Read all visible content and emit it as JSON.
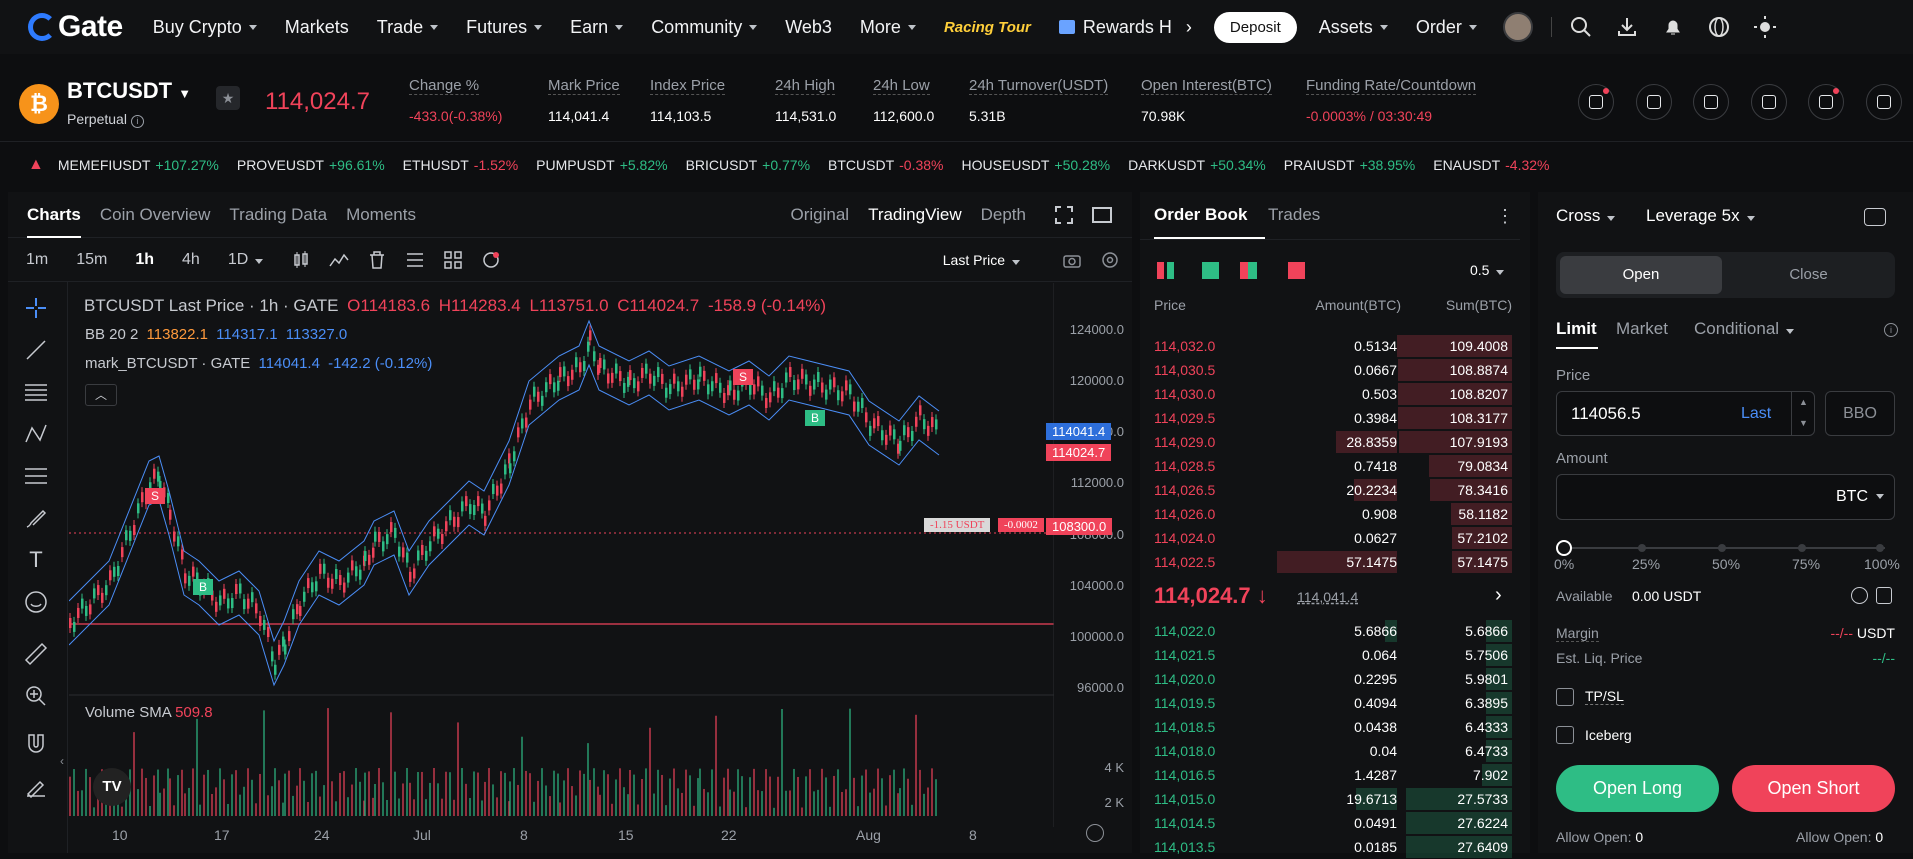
{
  "nav": {
    "logo": "Gate",
    "items": [
      "Buy Crypto",
      "Markets",
      "Trade",
      "Futures",
      "Earn",
      "Community",
      "Web3",
      "More"
    ],
    "has_chev": [
      true,
      false,
      true,
      true,
      true,
      true,
      false,
      true
    ],
    "promo": "Racing Tour",
    "rewards": "Rewards H",
    "deposit": "Deposit",
    "assets": "Assets",
    "order": "Order"
  },
  "header": {
    "symbol": "BTCUSDT",
    "type": "Perpetual",
    "last_price": "114,024.7",
    "stats": [
      {
        "label": "Change %",
        "value": "-433.0(-0.38%)",
        "color": "red"
      },
      {
        "label": "Mark Price",
        "value": "114,041.4",
        "color": "white"
      },
      {
        "label": "Index Price",
        "value": "114,103.5",
        "color": "white"
      },
      {
        "label": "24h High",
        "value": "114,531.0",
        "color": "white"
      },
      {
        "label": "24h Low",
        "value": "112,600.0",
        "color": "white"
      },
      {
        "label": "24h Turnover(USDT)",
        "value": "5.31B",
        "color": "white"
      },
      {
        "label": "Open Interest(BTC)",
        "value": "70.98K",
        "color": "white"
      },
      {
        "label": "Funding Rate/Countdown",
        "value": "-0.0003% / 03:30:49",
        "color": "red"
      }
    ]
  },
  "marquee": [
    {
      "sym": "MEMEFIUSDT",
      "chg": "+107.27%",
      "up": true
    },
    {
      "sym": "PROVEUSDT",
      "chg": "+96.61%",
      "up": true
    },
    {
      "sym": "ETHUSDT",
      "chg": "-1.52%",
      "up": false
    },
    {
      "sym": "PUMPUSDT",
      "chg": "+5.82%",
      "up": true
    },
    {
      "sym": "BRICUSDT",
      "chg": "+0.77%",
      "up": true
    },
    {
      "sym": "BTCUSDT",
      "chg": "-0.38%",
      "up": false
    },
    {
      "sym": "HOUSEUSDT",
      "chg": "+50.28%",
      "up": true
    },
    {
      "sym": "DARKUSDT",
      "chg": "+50.34%",
      "up": true
    },
    {
      "sym": "PRAIUSDT",
      "chg": "+38.95%",
      "up": true
    },
    {
      "sym": "ENAUSDT",
      "chg": "-4.32%",
      "up": false
    }
  ],
  "chart": {
    "tabs": [
      "Charts",
      "Coin Overview",
      "Trading Data",
      "Moments"
    ],
    "views": [
      "Original",
      "TradingView",
      "Depth"
    ],
    "timeframes": [
      "1m",
      "15m",
      "1h",
      "4h",
      "1D"
    ],
    "price_type": "Last Price",
    "legend1": {
      "title": "BTCUSDT Last Price · 1h · GATE",
      "o": "O114183.6",
      "h": "H114283.4",
      "l": "L113751.0",
      "c": "C114024.7",
      "chg": "-158.9 (-0.14%)"
    },
    "legend2": {
      "title": "BB 20 2",
      "v1": "113822.1",
      "v2": "114317.1",
      "v3": "113327.0"
    },
    "legend3": {
      "title": "mark_BTCUSDT · GATE",
      "v": "114041.4",
      "chg": "-142.2 (-0.12%)"
    },
    "volume": {
      "title": "Volume SMA",
      "v": "509.8"
    },
    "y_ticks": [
      "124000.0",
      "120000.0",
      "116000.0",
      "112000.0",
      "108000.0",
      "104000.0",
      "100000.0",
      "96000.0"
    ],
    "vol_ticks": [
      "4 K",
      "2 K"
    ],
    "x_ticks": [
      "10",
      "17",
      "24",
      "Jul",
      "8",
      "15",
      "22",
      "Aug",
      "8"
    ],
    "mark_tag": "114041.4",
    "last_tag": "114024.7",
    "line_tag": "108300.0",
    "pos_tag1": "-1.15 USDT",
    "pos_tag2": "-0.0002",
    "sell": "S",
    "buy": "B"
  },
  "orderbook": {
    "tabs": [
      "Order Book",
      "Trades"
    ],
    "precision": "0.5",
    "headers": [
      "Price",
      "Amount(BTC)",
      "Sum(BTC)"
    ],
    "asks": [
      [
        "114,032.0",
        "0.5134",
        "109.4008"
      ],
      [
        "114,030.5",
        "0.0667",
        "108.8874"
      ],
      [
        "114,030.0",
        "0.503",
        "108.8207"
      ],
      [
        "114,029.5",
        "0.3984",
        "108.3177"
      ],
      [
        "114,029.0",
        "28.8359",
        "107.9193"
      ],
      [
        "114,028.5",
        "0.7418",
        "79.0834"
      ],
      [
        "114,026.5",
        "20.2234",
        "78.3416"
      ],
      [
        "114,026.0",
        "0.908",
        "58.1182"
      ],
      [
        "114,024.0",
        "0.0627",
        "57.2102"
      ],
      [
        "114,022.5",
        "57.1475",
        "57.1475"
      ]
    ],
    "mid": "114,024.7",
    "mid_mark": "114,041.4",
    "bids": [
      [
        "114,022.0",
        "5.6866",
        "5.6866"
      ],
      [
        "114,021.5",
        "0.064",
        "5.7506"
      ],
      [
        "114,020.0",
        "0.2295",
        "5.9801"
      ],
      [
        "114,019.5",
        "0.4094",
        "6.3895"
      ],
      [
        "114,018.5",
        "0.0438",
        "6.4333"
      ],
      [
        "114,018.0",
        "0.04",
        "6.4733"
      ],
      [
        "114,016.5",
        "1.4287",
        "7.902"
      ],
      [
        "114,015.0",
        "19.6713",
        "27.5733"
      ],
      [
        "114,014.5",
        "0.0491",
        "27.6224"
      ],
      [
        "114,013.5",
        "0.0185",
        "27.6409"
      ]
    ]
  },
  "order": {
    "margin_mode": "Cross",
    "leverage": "Leverage 5x",
    "open": "Open",
    "close": "Close",
    "types": [
      "Limit",
      "Market",
      "Conditional"
    ],
    "price_label": "Price",
    "price_value": "114056.5",
    "last": "Last",
    "bbo": "BBO",
    "amount_label": "Amount",
    "unit": "BTC",
    "slider": [
      "0%",
      "25%",
      "50%",
      "75%",
      "100%"
    ],
    "available_label": "Available",
    "available": "0.00 USDT",
    "margin_label": "Margin",
    "margin_value": "--/--",
    "margin_unit": "USDT",
    "liq_label": "Est. Liq. Price",
    "liq_value": "--/--",
    "tpsl": "TP/SL",
    "iceberg": "Iceberg",
    "open_long": "Open Long",
    "open_short": "Open Short",
    "allow_open_label": "Allow Open:",
    "allow_open_long": "0",
    "allow_open_short": "0"
  },
  "colors": {
    "up": "#2ebd85",
    "down": "#f0435a",
    "bg": "#0d0e10",
    "panel": "#111214"
  }
}
